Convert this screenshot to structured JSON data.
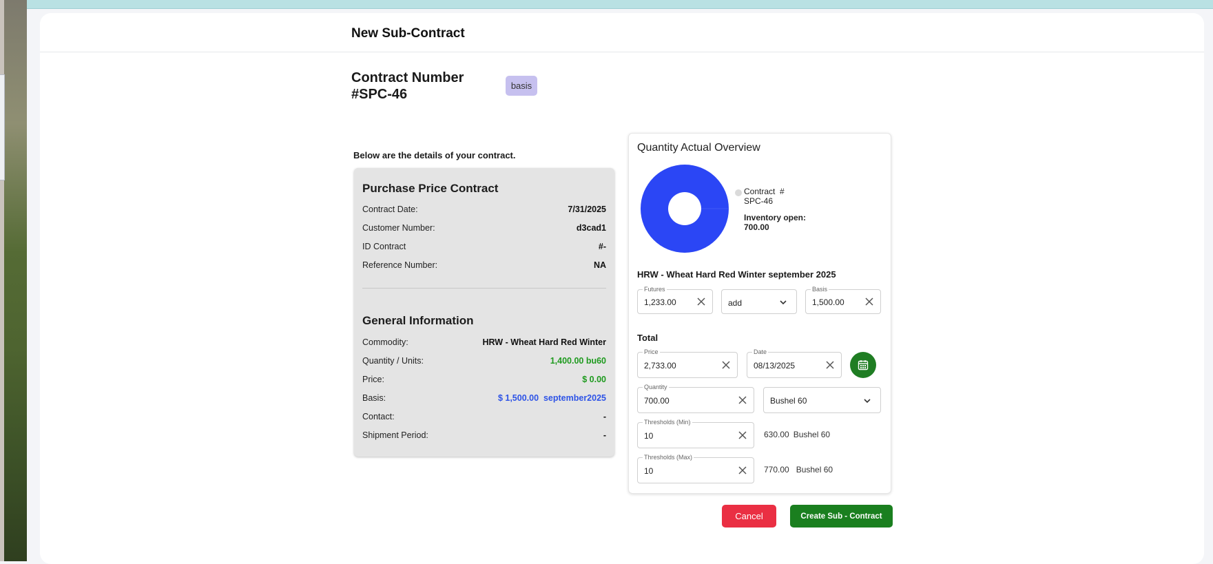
{
  "header": {
    "title": "New Sub-Contract"
  },
  "contract": {
    "heading_line1": "Contract Number",
    "heading_line2": "#SPC-46",
    "badge": "basis"
  },
  "intro": "Below are the details of your contract.",
  "purchase": {
    "title": "Purchase Price Contract",
    "rows": [
      {
        "label": "Contract Date:",
        "value": "7/31/2025"
      },
      {
        "label": "Customer Number:",
        "value": "d3cad1"
      },
      {
        "label": "ID Contract",
        "value": "#-"
      },
      {
        "label": "Reference Number:",
        "value": "NA"
      }
    ]
  },
  "general": {
    "title": "General Information",
    "rows": [
      {
        "label": "Commodity:",
        "value": "HRW - Wheat Hard Red Winter"
      },
      {
        "label": "Quantity / Units:",
        "value": "1,400.00 bu60"
      },
      {
        "label": "Price:",
        "value": "$ 0.00"
      },
      {
        "label": "Basis:",
        "value": "$ 1,500.00  september2025"
      },
      {
        "label": "Contact:",
        "value": "-"
      },
      {
        "label": "Shipment Period:",
        "value": "-"
      }
    ]
  },
  "overview": {
    "title": "Quantity Actual Overview",
    "legend_contract_line1": "Contract  #",
    "legend_contract_line2": "SPC-46",
    "legend_inventory_label": "Inventory open:",
    "legend_inventory_value": "700.00",
    "commodity_title": "HRW - Wheat Hard Red Winter september 2025",
    "futures": {
      "label": "Futures",
      "value": "1,233.00"
    },
    "operation": {
      "value": "add"
    },
    "basis": {
      "label": "Basis",
      "value": "1,500.00"
    },
    "total_title": "Total",
    "price": {
      "label": "Price",
      "value": "2,733.00"
    },
    "date": {
      "label": "Date",
      "value": "08/13/2025"
    },
    "quantity": {
      "label": "Quantity",
      "value": "700.00"
    },
    "unit": {
      "value": "Bushel 60"
    },
    "threshold_min": {
      "label": "Thresholds (Min)",
      "value": "10",
      "computed": "630.00",
      "unit": "Bushel 60"
    },
    "threshold_max": {
      "label": "Thresholds (Max)",
      "value": "10",
      "computed": "770.00",
      "unit": "Bushel 60"
    }
  },
  "actions": {
    "cancel": "Cancel",
    "create": "Create Sub - Contract"
  },
  "colors": {
    "donut": "#2b46f5",
    "primary_green": "#1a7f1f",
    "cancel_red": "#ea2f43",
    "badge": "#c6c0ef",
    "value_green": "#1e9a1e",
    "value_blue": "#2d53e6"
  }
}
